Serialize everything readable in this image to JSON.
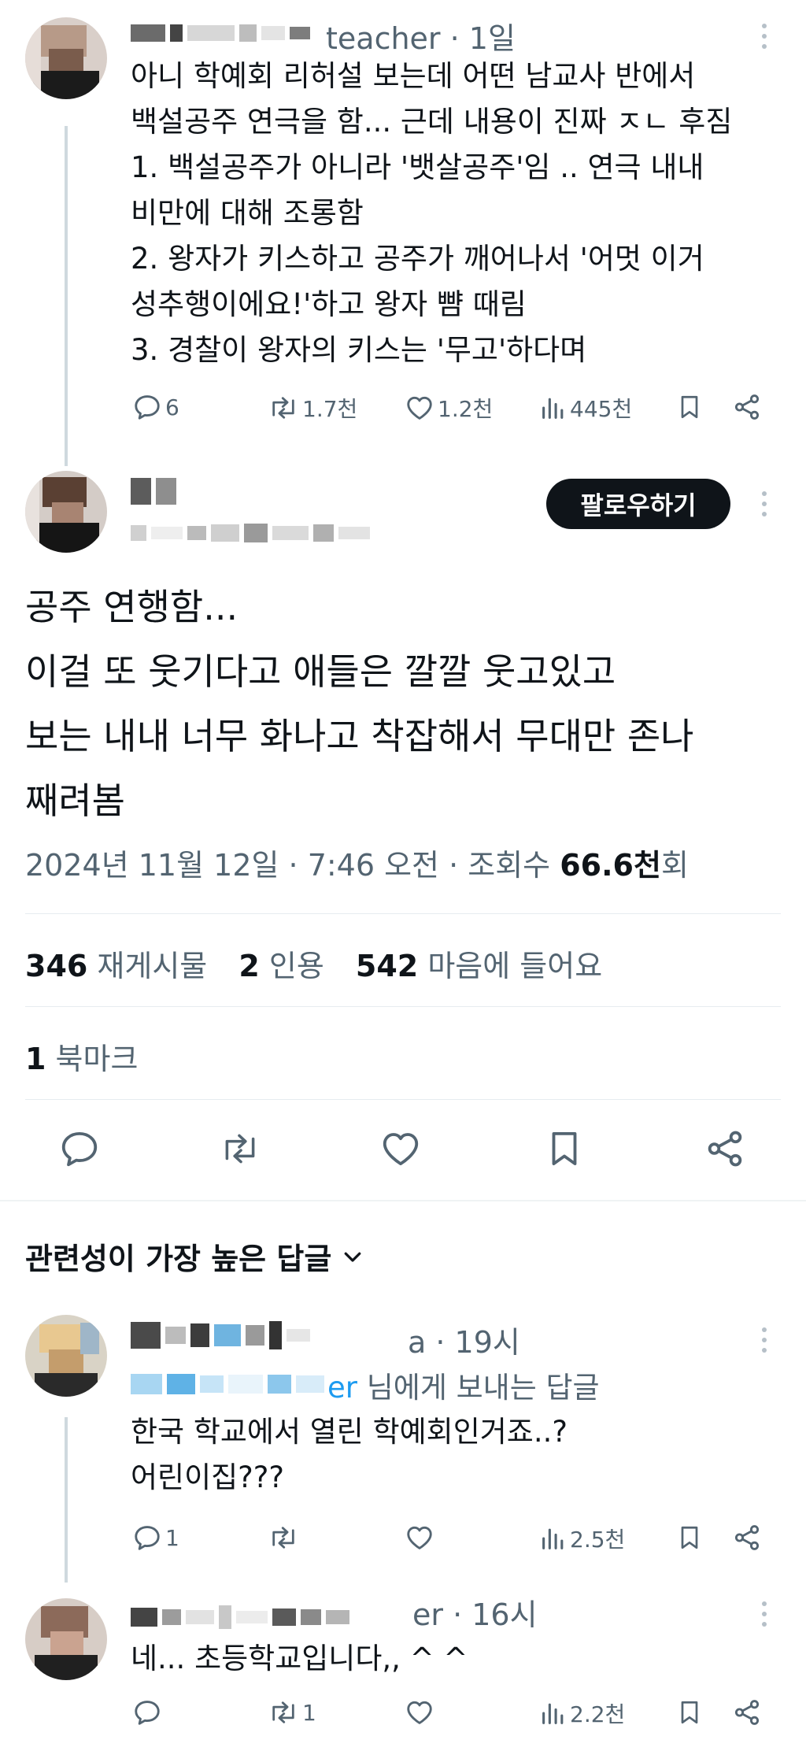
{
  "post1": {
    "handle_meta": "teacher · 1일",
    "lines": [
      "아니 학예회 리허설 보는데 어떤 남교사 반에서",
      "백설공주 연극을 함... 근데 내용이 진짜 ㅈㄴ 후짐",
      "1. 백설공주가 아니라 '뱃살공주'임 .. 연극 내내",
      "비만에 대해 조롱함",
      "2. 왕자가 키스하고 공주가 깨어나서 '어멋 이거",
      "성추행이에요!'하고 왕자 뺨 때림",
      "3. 경찰이 왕자의 키스는 '무고'하다며"
    ],
    "replies": "6",
    "reposts": "1.7천",
    "likes": "1.2천",
    "views": "445천"
  },
  "post2": {
    "follow_label": "팔로우하기",
    "lines": [
      "공주 연행함...",
      "이걸 또 웃기다고 애들은 깔깔 웃고있고",
      "보는 내내 너무 화나고 착잡해서 무대만 존나",
      "째려봄"
    ],
    "timestamp": "2024년 11월 12일 · 7:46 오전 · 조회수 ",
    "views_value": "66.6천",
    "views_suffix": "회",
    "reposts_count": "346",
    "reposts_label": "재게시물",
    "quotes_count": "2",
    "quotes_label": "인용",
    "likes_count": "542",
    "likes_label": "마음에 들어요",
    "bookmarks_count": "1",
    "bookmarks_label": "북마크"
  },
  "replies_section": {
    "title": "관련성이 가장 높은 답글"
  },
  "reply1": {
    "handle_meta": "a · 19시",
    "reply_to_handle": "er",
    "reply_to_suffix": " 님에게 보내는 답글",
    "lines": [
      "한국 학교에서 열린 학예회인거죠..?",
      "어린이집???"
    ],
    "replies": "1",
    "reposts": "",
    "likes": "",
    "views": "2.5천"
  },
  "reply2": {
    "handle_meta": "er · 16시",
    "lines": [
      "네... 초등학교입니다,, ^ ^"
    ],
    "replies": "",
    "reposts": "1",
    "likes": "",
    "views": "2.2천"
  },
  "colors": {
    "text_primary": "#0f1419",
    "text_secondary": "#536471",
    "accent": "#1d9bf0",
    "follow_bg": "#0f1419"
  },
  "icons": [
    "reply-icon",
    "repost-icon",
    "like-icon",
    "views-icon",
    "bookmark-icon",
    "share-icon",
    "more-icon",
    "chevron-down-icon"
  ]
}
